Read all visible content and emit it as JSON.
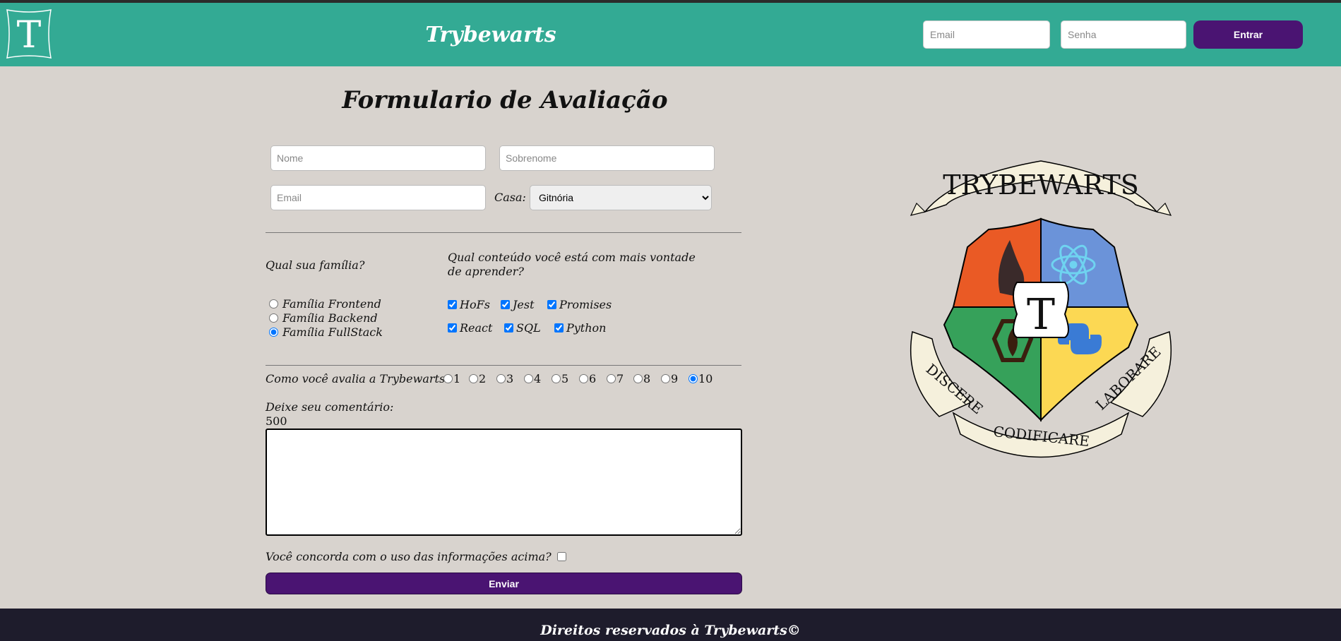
{
  "header": {
    "logo_letter": "T",
    "site_title": "Trybewarts",
    "login": {
      "email_placeholder": "Email",
      "password_placeholder": "Senha",
      "submit_label": "Entrar"
    }
  },
  "form": {
    "title": "Formulario de Avaliação",
    "fields": {
      "name_placeholder": "Nome",
      "lastname_placeholder": "Sobrenome",
      "email_placeholder": "Email"
    },
    "house": {
      "label": "Casa:",
      "selected": "Gitnória"
    },
    "family": {
      "question": "Qual sua família?",
      "options": [
        {
          "label": "Família Frontend",
          "checked": false
        },
        {
          "label": "Família Backend",
          "checked": false
        },
        {
          "label": "Família FullStack",
          "checked": true
        }
      ]
    },
    "content": {
      "question": "Qual conteúdo você está com mais vontade de aprender?",
      "options": [
        {
          "label": "HoFs",
          "checked": true
        },
        {
          "label": "Jest",
          "checked": true
        },
        {
          "label": "Promises",
          "checked": true
        },
        {
          "label": "React",
          "checked": true
        },
        {
          "label": "SQL",
          "checked": true
        },
        {
          "label": "Python",
          "checked": true
        }
      ]
    },
    "rating": {
      "question": "Como você avalia a Trybewarts?",
      "options": [
        "1",
        "2",
        "3",
        "4",
        "5",
        "6",
        "7",
        "8",
        "9",
        "10"
      ],
      "selected": "10"
    },
    "comment": {
      "label": "Deixe seu comentário:",
      "counter": "500",
      "value": ""
    },
    "agreement": {
      "label": "Você concorda com o uso das informações acima?",
      "checked": false
    },
    "submit_label": "Enviar"
  },
  "crest": {
    "banner_top": "TRYBEWARTS",
    "center_letter": "T",
    "motto_left": "DISCERE",
    "motto_bottom": "CODIFICARE",
    "motto_right": "LABORARE",
    "colors": {
      "red": "#ea5a25",
      "blue": "#6b93d9",
      "green": "#36a15a",
      "yellow": "#fcd853"
    }
  },
  "footer": {
    "text": "Direitos reservados à Trybewarts©"
  },
  "colors": {
    "header_bg": "#33aa94",
    "page_bg": "#d8d3ce",
    "accent_purple": "#4a1472",
    "footer_bg": "#1e1c2c"
  }
}
